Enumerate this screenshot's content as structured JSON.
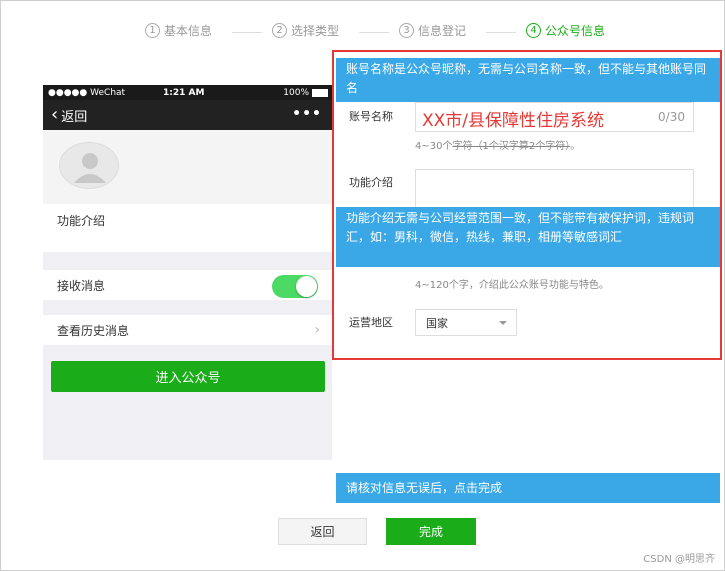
{
  "steps": [
    {
      "num": "1",
      "label": "基本信息"
    },
    {
      "num": "2",
      "label": "选择类型"
    },
    {
      "num": "3",
      "label": "信息登记"
    },
    {
      "num": "4",
      "label": "公众号信息"
    }
  ],
  "phone": {
    "carrier": "●●●●● WeChat",
    "time": "1:21 AM",
    "battery": "100%",
    "back_label": "返回",
    "more": "•••",
    "row_intro": "功能介绍",
    "row_receive": "接收消息",
    "row_history": "查看历史消息",
    "enter_button": "进入公众号",
    "receive_enabled": true
  },
  "form": {
    "name_label": "账号名称",
    "name_value": "XX市/县保障性住房系统",
    "name_counter": "0/30",
    "name_hint_a": "4~30个",
    "name_hint_b": "字符（1个汉字算2个字符）",
    "name_hint_c": "。",
    "intro_label": "功能介绍",
    "intro_value": "",
    "intro_hint": "4~120个字，介绍此公众账号功能与特色。",
    "region_label": "运营地区",
    "region_value": "国家"
  },
  "tips": {
    "tip1": "账号名称是公众号昵称，无需与公司名称一致，但不能与其他账号同名",
    "tip2": "功能介绍无需与公司经营范围一致，但不能带有被保护词，违规词汇，如：男科，微信，热线，兼职，相册等敏感词汇",
    "tip3": "请核对信息无误后，点击完成"
  },
  "buttons": {
    "back": "返回",
    "done": "完成"
  },
  "watermark": "CSDN @明思齐",
  "colors": {
    "accent_green": "#1aad19",
    "tip_blue": "#3aa8e6",
    "highlight_red": "#e53935"
  }
}
